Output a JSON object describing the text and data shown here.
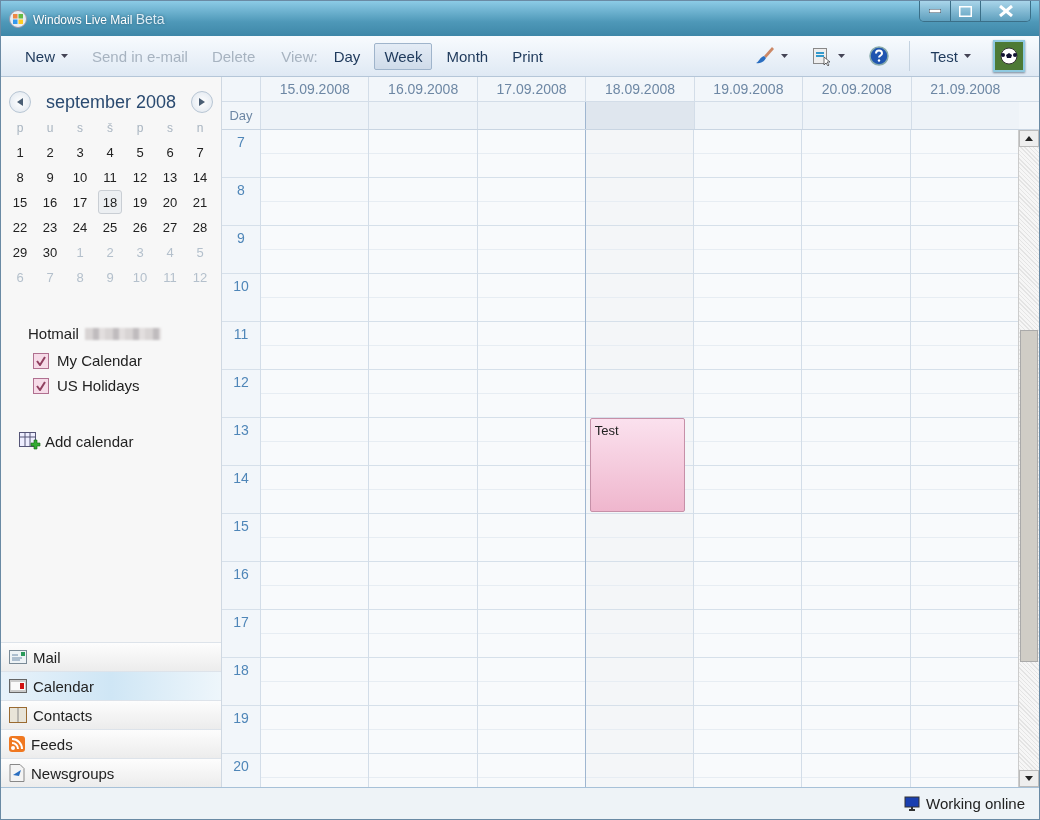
{
  "window": {
    "title": "Windows Live Mail",
    "title_suffix": "Beta"
  },
  "toolbar": {
    "new": {
      "label": "New"
    },
    "actions": [
      {
        "label": "Send in e-mail",
        "disabled": true
      },
      {
        "label": "Delete",
        "disabled": true
      }
    ],
    "view_label": "View:",
    "views": [
      {
        "label": "Day",
        "selected": false
      },
      {
        "label": "Week",
        "selected": true
      },
      {
        "label": "Month",
        "selected": false
      }
    ],
    "print": "Print",
    "user": "Test"
  },
  "mini_calendar": {
    "month": "september 2008",
    "weekdays": [
      "p",
      "u",
      "s",
      "š",
      "p",
      "s",
      "n"
    ],
    "weeks": [
      [
        {
          "label": "1",
          "other": false,
          "selected": false
        },
        {
          "label": "2",
          "other": false,
          "selected": false
        },
        {
          "label": "3",
          "other": false,
          "selected": false
        },
        {
          "label": "4",
          "other": false,
          "selected": false
        },
        {
          "label": "5",
          "other": false,
          "selected": false
        },
        {
          "label": "6",
          "other": false,
          "selected": false
        },
        {
          "label": "7",
          "other": false,
          "selected": false
        }
      ],
      [
        {
          "label": "8",
          "other": false,
          "selected": false
        },
        {
          "label": "9",
          "other": false,
          "selected": false
        },
        {
          "label": "10",
          "other": false,
          "selected": false
        },
        {
          "label": "11",
          "other": false,
          "selected": false
        },
        {
          "label": "12",
          "other": false,
          "selected": false
        },
        {
          "label": "13",
          "other": false,
          "selected": false
        },
        {
          "label": "14",
          "other": false,
          "selected": false
        }
      ],
      [
        {
          "label": "15",
          "other": false,
          "selected": false
        },
        {
          "label": "16",
          "other": false,
          "selected": false
        },
        {
          "label": "17",
          "other": false,
          "selected": false
        },
        {
          "label": "18",
          "other": false,
          "selected": true
        },
        {
          "label": "19",
          "other": false,
          "selected": false
        },
        {
          "label": "20",
          "other": false,
          "selected": false
        },
        {
          "label": "21",
          "other": false,
          "selected": false
        }
      ],
      [
        {
          "label": "22",
          "other": false,
          "selected": false
        },
        {
          "label": "23",
          "other": false,
          "selected": false
        },
        {
          "label": "24",
          "other": false,
          "selected": false
        },
        {
          "label": "25",
          "other": false,
          "selected": false
        },
        {
          "label": "26",
          "other": false,
          "selected": false
        },
        {
          "label": "27",
          "other": false,
          "selected": false
        },
        {
          "label": "28",
          "other": false,
          "selected": false
        }
      ],
      [
        {
          "label": "29",
          "other": false,
          "selected": false
        },
        {
          "label": "30",
          "other": false,
          "selected": false
        },
        {
          "label": "1",
          "other": true,
          "selected": false
        },
        {
          "label": "2",
          "other": true,
          "selected": false
        },
        {
          "label": "3",
          "other": true,
          "selected": false
        },
        {
          "label": "4",
          "other": true,
          "selected": false
        },
        {
          "label": "5",
          "other": true,
          "selected": false
        }
      ],
      [
        {
          "label": "6",
          "other": true,
          "selected": false
        },
        {
          "label": "7",
          "other": true,
          "selected": false
        },
        {
          "label": "8",
          "other": true,
          "selected": false
        },
        {
          "label": "9",
          "other": true,
          "selected": false
        },
        {
          "label": "10",
          "other": true,
          "selected": false
        },
        {
          "label": "11",
          "other": true,
          "selected": false
        },
        {
          "label": "12",
          "other": true,
          "selected": false
        }
      ]
    ]
  },
  "account": {
    "name": "Hotmail",
    "calendars": [
      {
        "label": "My Calendar",
        "checked": true
      },
      {
        "label": "US Holidays",
        "checked": true
      }
    ]
  },
  "add_calendar": "Add calendar",
  "nav": [
    {
      "label": "Mail",
      "selected": false
    },
    {
      "label": "Calendar",
      "selected": true
    },
    {
      "label": "Contacts",
      "selected": false
    },
    {
      "label": "Feeds",
      "selected": false
    },
    {
      "label": "Newsgroups",
      "selected": false
    }
  ],
  "week": {
    "allday_label": "Day",
    "days": [
      {
        "date": "15.09.2008",
        "selected": false
      },
      {
        "date": "16.09.2008",
        "selected": false
      },
      {
        "date": "17.09.2008",
        "selected": false
      },
      {
        "date": "18.09.2008",
        "selected": true
      },
      {
        "date": "19.09.2008",
        "selected": false
      },
      {
        "date": "20.09.2008",
        "selected": false
      },
      {
        "date": "21.09.2008",
        "selected": false
      }
    ],
    "hours": [
      {
        "label": "7"
      },
      {
        "label": "8"
      },
      {
        "label": "9"
      },
      {
        "label": "10"
      },
      {
        "label": "11"
      },
      {
        "label": "12"
      },
      {
        "label": "13",
        "events": [
          {
            "title": "Test",
            "kind": "two_hour"
          }
        ]
      },
      {
        "label": "14"
      },
      {
        "label": "15"
      },
      {
        "label": "16"
      },
      {
        "label": "17"
      },
      {
        "label": "18"
      },
      {
        "label": "19"
      },
      {
        "label": "20"
      }
    ]
  },
  "status_bar": {
    "text": "Working online"
  }
}
